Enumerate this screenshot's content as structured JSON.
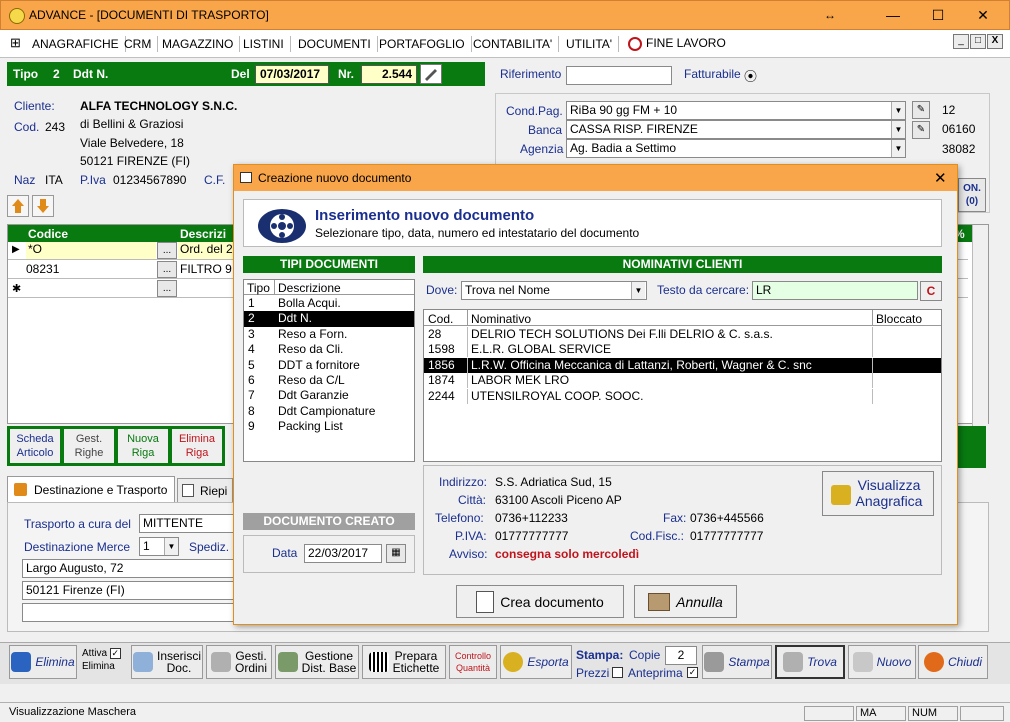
{
  "window": {
    "title": "ADVANCE - [DOCUMENTI DI TRASPORTO]",
    "resize_glyph": "↔",
    "minimize": "—",
    "maximize": "☐",
    "close": "✕"
  },
  "menu": {
    "icon": "⊞",
    "items": [
      "ANAGRAFICHE",
      "CRM",
      "MAGAZZINO",
      "LISTINI",
      "DOCUMENTI",
      "PORTAFOGLIO",
      "CONTABILITA'",
      "UTILITA'"
    ],
    "fine": "FINE LAVORO",
    "mdi": [
      "_",
      "□",
      "X"
    ]
  },
  "header": {
    "tipo_label": "Tipo",
    "tipo_value": "2",
    "ddt_label": "Ddt N.",
    "del_label": "Del",
    "date": "07/03/2017",
    "nr_label": "Nr.",
    "nr": "2.544",
    "riferimento_label": "Riferimento",
    "riferimento": "",
    "fatturabile_label": "Fatturabile",
    "radio": "⦿"
  },
  "client": {
    "label": "Cliente:",
    "name": "ALFA TECHNOLOGY S.N.C.",
    "cod_label": "Cod.",
    "cod": "243",
    "line1": "di Bellini &  Graziosi",
    "line2": "Viale Belvedere, 18",
    "line3": "50121 FIRENZE (FI)",
    "naz_label": "Naz",
    "naz": "ITA",
    "piva_label": "P.Iva",
    "piva": "01234567890",
    "cf_label": "C.F."
  },
  "payment": {
    "cond_label": "Cond.Pag.",
    "cond": "RiBa 90 gg FM + 10",
    "cond_code": "12",
    "banca_label": "Banca",
    "banca": "CASSA RISP. FIRENZE",
    "banca_code": "06160",
    "agenzia_label": "Agenzia",
    "agenzia": "Ag. Badia a Settimo",
    "agenzia_code": "38082",
    "side_btn": "ON.",
    "side_btn2": "(0)"
  },
  "grid": {
    "col_codice": "Codice",
    "col_descr": "Descrizi",
    "rows": [
      {
        "marker": "▶",
        "codice": "*O",
        "descr": "Ord. del 2"
      },
      {
        "marker": "",
        "codice": "08231",
        "descr": "FILTRO 9"
      },
      {
        "marker": "✱",
        "codice": "",
        "descr": ""
      }
    ],
    "dots": "...",
    "pct": "%"
  },
  "left_buttons": {
    "scheda": "Scheda",
    "articolo": "Articolo",
    "gest": "Gest.",
    "righe": "Righe",
    "nuova": "Nuova",
    "riga": "Riga",
    "elimina": "Elimina",
    "riga2": "Riga"
  },
  "tabs": {
    "dest": "Destinazione e Trasporto",
    "riep": "Riepi"
  },
  "transport": {
    "cura_label": "Trasporto a cura del",
    "cura": "MITTENTE",
    "dest_label": "Destinazione Merce",
    "dest": "1",
    "spediz_label": "Spediz.",
    "addr1": "Largo Augusto, 72",
    "addr2": "50121 Firenze (FI)"
  },
  "dialog": {
    "title": "Creazione nuovo documento",
    "close": "✕",
    "heading": "Inserimento nuovo documento",
    "subheading": "Selezionare tipo, data, numero ed intestatario del documento",
    "tipi_title": "TIPI DOCUMENTI",
    "tipo_col": "Tipo",
    "descr_col": "Descrizione",
    "tipi": [
      {
        "n": "1",
        "d": "Bolla Acqui."
      },
      {
        "n": "2",
        "d": "Ddt N."
      },
      {
        "n": "3",
        "d": "Reso a Forn."
      },
      {
        "n": "4",
        "d": "Reso da Cli."
      },
      {
        "n": "5",
        "d": "DDT a fornitore"
      },
      {
        "n": "6",
        "d": "Reso da C/L"
      },
      {
        "n": "7",
        "d": "Ddt Garanzie"
      },
      {
        "n": "8",
        "d": "Ddt Campionature"
      },
      {
        "n": "9",
        "d": "Packing List"
      }
    ],
    "nom_title": "NOMINATIVI CLIENTI",
    "dove_label": "Dove:",
    "dove": "Trova nel Nome",
    "testo_label": "Testo da cercare:",
    "testo": "LR",
    "c_btn": "C",
    "col_cod": "Cod.",
    "col_nom": "Nominativo",
    "col_blocc": "Bloccato",
    "clients": [
      {
        "cod": "28",
        "nom": "DELRIO TECH SOLUTIONS Dei F.lli DELRIO & C. s.a.s."
      },
      {
        "cod": "1598",
        "nom": "E.L.R. GLOBAL SERVICE"
      },
      {
        "cod": "1856",
        "nom": "L.R.W. Officina Meccanica di Lattanzi, Roberti, Wagner & C. snc"
      },
      {
        "cod": "1874",
        "nom": "LABOR MEK LRO"
      },
      {
        "cod": "2244",
        "nom": "UTENSILROYAL COOP. SOOC."
      }
    ],
    "doc_creato": "DOCUMENTO CREATO",
    "data_label": "Data",
    "data": "22/03/2017",
    "ind_label": "Indirizzo:",
    "ind": "S.S. Adriatica Sud, 15",
    "citta_label": "Città:",
    "citta": "63100 Ascoli Piceno AP",
    "tel_label": "Telefono:",
    "tel": "0736+112233",
    "fax_label": "Fax:",
    "fax": "0736+445566",
    "piva_label": "P.IVA:",
    "piva": "01777777777",
    "codf_label": "Cod.Fisc.:",
    "codf": "01777777777",
    "avviso_label": "Avviso:",
    "avviso": "consegna solo mercoledì",
    "vis1": "Visualizza",
    "vis2": "Anagrafica",
    "crea": "Crea documento",
    "annulla": "Annulla"
  },
  "toolbar": {
    "elimina": "Elimina",
    "attiva": "Attiva",
    "elimina2": "Elimina",
    "inserisci1": "Inserisci",
    "inserisci2": "Doc.",
    "gesti1": "Gesti.",
    "gesti2": "Ordini",
    "gestione1": "Gestione",
    "gestione2": "Dist. Base",
    "prepara1": "Prepara",
    "prepara2": "Etichette",
    "controllo1": "Controllo",
    "controllo2": "Quantità",
    "esporta": "Esporta",
    "stampa_label": "Stampa:",
    "copie_label": "Copie",
    "copie": "2",
    "prezzi_label": "Prezzi",
    "anteprima_label": "Anteprima",
    "stampa": "Stampa",
    "trova": "Trova",
    "nuovo": "Nuovo",
    "chiudi": "Chiudi",
    "check": "✓"
  },
  "status": {
    "text": "Visualizzazione Maschera",
    "ma": "MA",
    "num": "NUM"
  },
  "colors": {
    "green": "#087a10",
    "orange": "#f9a54a",
    "red": "#c0141c"
  }
}
